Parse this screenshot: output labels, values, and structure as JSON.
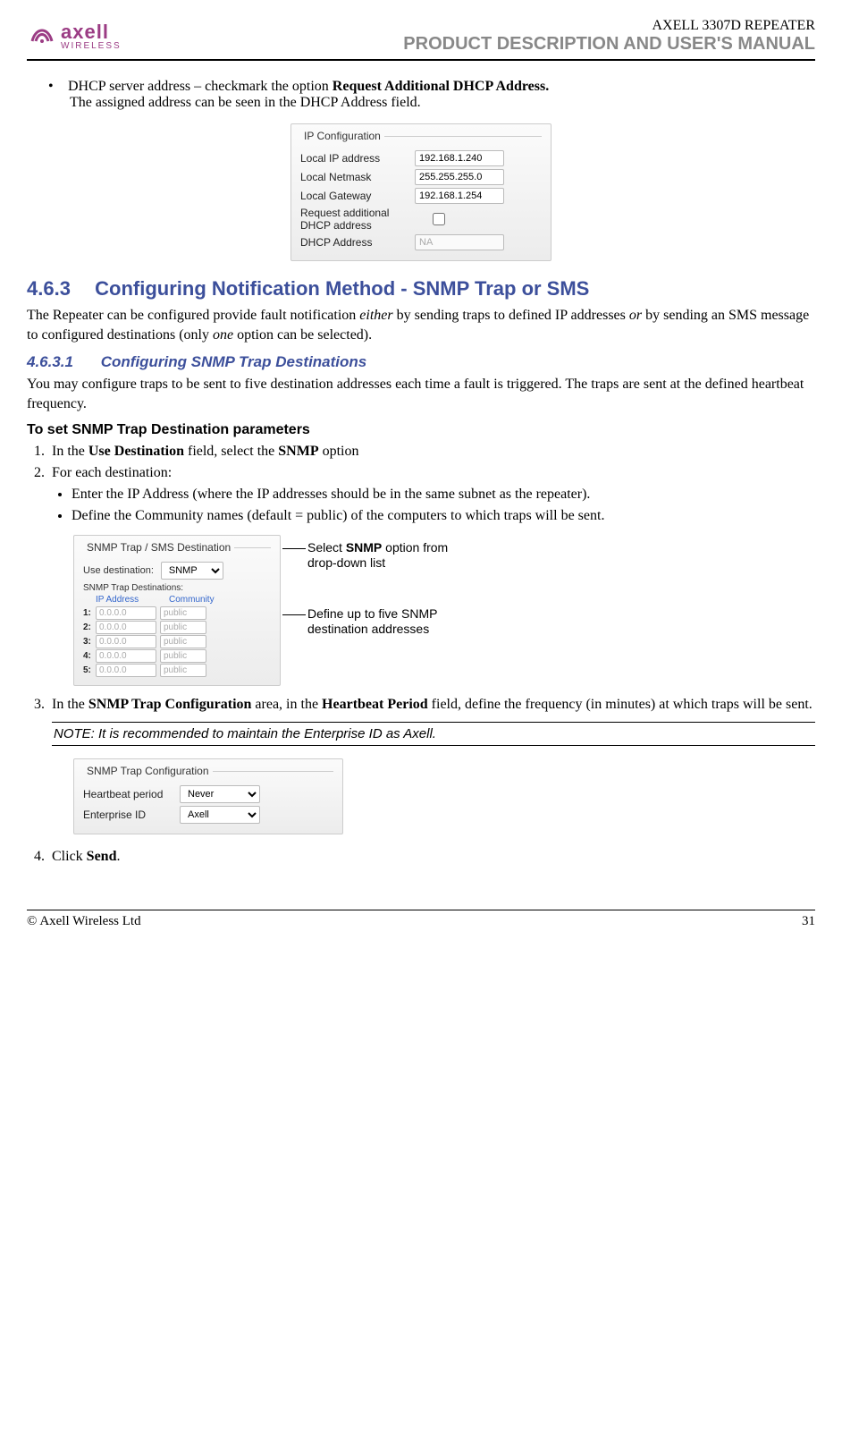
{
  "header": {
    "brand_name": "axell",
    "brand_sub": "WIRELESS",
    "product": "AXELL 3307D REPEATER",
    "doc_title": "PRODUCT DESCRIPTION AND USER'S MANUAL"
  },
  "intro_bullet": {
    "prefix": "DHCP server address – checkmark the option ",
    "bold": "Request Additional DHCP Address.",
    "line2": "The assigned address can be seen in the DHCP Address field."
  },
  "ip_config": {
    "fieldset_title": "IP Configuration",
    "rows": {
      "local_ip_label": "Local IP address",
      "local_ip_value": "192.168.1.240",
      "netmask_label": "Local Netmask",
      "netmask_value": "255.255.255.0",
      "gateway_label": "Local Gateway",
      "gateway_value": "192.168.1.254",
      "req_label_1": "Request additional",
      "req_label_2": "DHCP address",
      "dhcp_addr_label": "DHCP Address",
      "dhcp_addr_value": "NA"
    }
  },
  "section_463": {
    "number": "4.6.3",
    "title": "Configuring Notification Method - SNMP Trap or SMS",
    "body": "The Repeater can be configured provide fault notification either by sending traps to defined IP addresses or by sending an SMS message to configured destinations (only one option can be selected).",
    "italic_1": "either",
    "italic_2": "or",
    "italic_3": "one"
  },
  "section_4631": {
    "number": "4.6.3.1",
    "title": "Configuring SNMP Trap Destinations",
    "body": "You may configure traps to be sent to five destination addresses each time a fault is triggered. The traps are sent at the defined heartbeat frequency."
  },
  "procedure": {
    "title": "To set SNMP Trap Destination parameters",
    "step1_prefix": "In the ",
    "step1_bold1": "Use Destination",
    "step1_mid": " field, select the ",
    "step1_bold2": "SNMP",
    "step1_suffix": " option",
    "step2": "For each destination:",
    "sub_a": "Enter the IP Address (where the IP addresses should be in the same subnet as the repeater).",
    "sub_b": "Define the Community names (default = public) of the computers to which traps will be sent.",
    "step3_prefix": "In the ",
    "step3_bold1": "SNMP Trap Configuration",
    "step3_mid": " area, in the ",
    "step3_bold2": "Heartbeat Period",
    "step3_suffix": " field, define the frequency (in minutes) at which traps will be sent.",
    "step4_prefix": "Click ",
    "step4_bold": "Send",
    "step4_suffix": "."
  },
  "snmp_panel": {
    "fieldset_title": "SNMP Trap / SMS Destination",
    "use_dest_label": "Use destination:",
    "use_dest_value": "SNMP",
    "table_label": "SNMP Trap Destinations:",
    "col_ip": "IP Address",
    "col_comm": "Community",
    "rows": [
      {
        "idx": "1:",
        "ip": "0.0.0.0",
        "comm": "public"
      },
      {
        "idx": "2:",
        "ip": "0.0.0.0",
        "comm": "public"
      },
      {
        "idx": "3:",
        "ip": "0.0.0.0",
        "comm": "public"
      },
      {
        "idx": "4:",
        "ip": "0.0.0.0",
        "comm": "public"
      },
      {
        "idx": "5:",
        "ip": "0.0.0.0",
        "comm": "public"
      }
    ]
  },
  "annotations": {
    "a1_line1": "Select ",
    "a1_bold": "SNMP",
    "a1_line1_suffix": " option from",
    "a1_line2": "drop-down list",
    "a2_line1": "Define up to five SNMP",
    "a2_line2": "destination addresses"
  },
  "note": "NOTE: It is recommended to maintain the Enterprise ID as Axell.",
  "conf_panel": {
    "fieldset_title": "SNMP Trap Configuration",
    "heartbeat_label": "Heartbeat period",
    "heartbeat_value": "Never",
    "enterprise_label": "Enterprise ID",
    "enterprise_value": "Axell"
  },
  "footer": {
    "left": "© Axell Wireless Ltd",
    "right": "31"
  }
}
